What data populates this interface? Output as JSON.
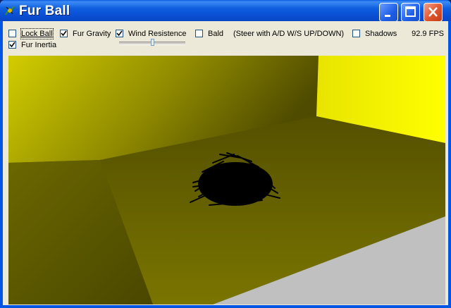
{
  "window": {
    "title": "Fur Ball"
  },
  "options": {
    "lock_ball": {
      "label": "Lock Ball",
      "checked": false
    },
    "fur_gravity": {
      "label": "Fur Gravity",
      "checked": true
    },
    "wind_resistence": {
      "label": "Wind Resistence",
      "checked": true
    },
    "bald": {
      "label": "Bald",
      "checked": false
    },
    "steer_hint": "(Steer with A/D W/S UP/DOWN)",
    "shadows": {
      "label": "Shadows",
      "checked": false
    },
    "fur_inertia": {
      "label": "Fur Inertia",
      "checked": true
    }
  },
  "wind_slider": {
    "value_fraction": 0.5
  },
  "fps_text": "92.9 FPS",
  "icons": {
    "app": "fur-ball-app-icon",
    "minimize": "minimize-icon",
    "maximize": "maximize-icon",
    "close": "close-icon",
    "check": "checkmark-icon"
  },
  "colors": {
    "titlebar": "#0a50d5",
    "scene_yellow": "#ffff00",
    "scene_floor": "#5a5600",
    "scene_floor_right": "#c0c0c0"
  }
}
